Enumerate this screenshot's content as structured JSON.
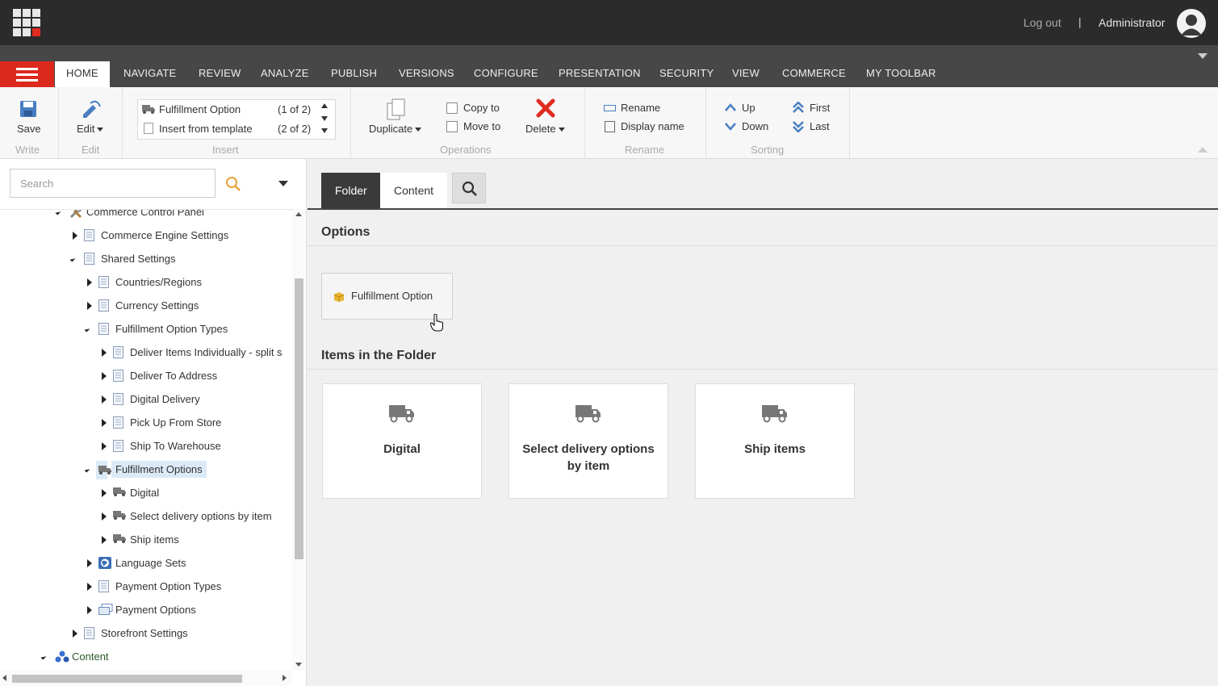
{
  "topbar": {
    "logout": "Log out",
    "separator": "|",
    "username": "Administrator"
  },
  "ribbon_tabs": [
    "HOME",
    "NAVIGATE",
    "REVIEW",
    "ANALYZE",
    "PUBLISH",
    "VERSIONS",
    "CONFIGURE",
    "PRESENTATION",
    "SECURITY",
    "VIEW",
    "COMMERCE",
    "MY TOOLBAR"
  ],
  "ribbon": {
    "save": "Save",
    "edit": "Edit",
    "group_write": "Write",
    "group_edit": "Edit",
    "insert_items": [
      {
        "label": "Fulfillment Option",
        "count": "(1 of 2)"
      },
      {
        "label": "Insert from template",
        "count": "(2 of 2)"
      }
    ],
    "group_insert": "Insert",
    "duplicate": "Duplicate",
    "copy_to": "Copy to",
    "move_to": "Move to",
    "delete": "Delete",
    "group_operations": "Operations",
    "rename": "Rename",
    "display_name": "Display name",
    "group_rename": "Rename",
    "up": "Up",
    "down": "Down",
    "first": "First",
    "last": "Last",
    "group_sorting": "Sorting"
  },
  "search": {
    "placeholder": "Search"
  },
  "tree": [
    {
      "label": "Commerce Control Panel",
      "state": "open",
      "icon": "tools-icon"
    },
    {
      "label": "Commerce Engine Settings",
      "state": "closed",
      "icon": "page-icon"
    },
    {
      "label": "Shared Settings",
      "state": "open",
      "icon": "page-icon"
    },
    {
      "label": "Countries/Regions",
      "state": "closed",
      "icon": "page-icon"
    },
    {
      "label": "Currency Settings",
      "state": "closed",
      "icon": "page-icon"
    },
    {
      "label": "Fulfillment Option Types",
      "state": "open",
      "icon": "page-icon"
    },
    {
      "label": "Deliver Items Individually - split s",
      "state": "closed",
      "icon": "page-icon"
    },
    {
      "label": "Deliver To Address",
      "state": "closed",
      "icon": "page-icon"
    },
    {
      "label": "Digital Delivery",
      "state": "closed",
      "icon": "page-icon"
    },
    {
      "label": "Pick Up From Store",
      "state": "closed",
      "icon": "page-icon"
    },
    {
      "label": "Ship To Warehouse",
      "state": "closed",
      "icon": "page-icon"
    },
    {
      "label": "Fulfillment Options",
      "state": "open",
      "icon": "truck-icon",
      "selected": true
    },
    {
      "label": "Digital",
      "state": "closed",
      "icon": "truck-icon"
    },
    {
      "label": "Select delivery options by item",
      "state": "closed",
      "icon": "truck-icon"
    },
    {
      "label": "Ship items",
      "state": "closed",
      "icon": "truck-icon"
    },
    {
      "label": "Language Sets",
      "state": "closed",
      "icon": "globe-icon"
    },
    {
      "label": "Payment Option Types",
      "state": "closed",
      "icon": "page-icon"
    },
    {
      "label": "Payment Options",
      "state": "closed",
      "icon": "payment-icon"
    },
    {
      "label": "Storefront Settings",
      "state": "closed",
      "icon": "page-icon"
    },
    {
      "label": "Content",
      "state": "open",
      "icon": "content-icon"
    }
  ],
  "content": {
    "tab_folder": "Folder",
    "tab_content": "Content",
    "options_title": "Options",
    "option_button": "Fulfillment Option",
    "items_title": "Items in the Folder",
    "items": [
      "Digital",
      "Select delivery options by item",
      "Ship items"
    ]
  }
}
